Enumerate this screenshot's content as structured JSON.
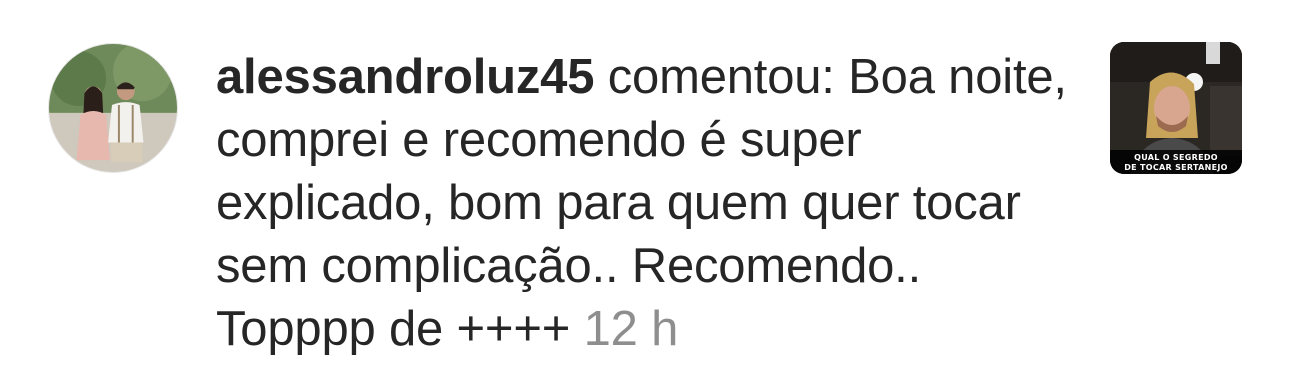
{
  "notification": {
    "username": "alessandroluz45",
    "action": "comentou:",
    "comment_text": "Boa noite, comprei e recomendo é super explicado, bom para quem quer tocar sem complicação.. Recomendo.. Topppp de ++++",
    "timestamp": "12 h",
    "avatar_icon": "profile-photo-couple",
    "thumbnail": {
      "icon": "video-thumbnail",
      "caption_line1": "QUAL O SEGREDO",
      "caption_line2": "DE TOCAR SERTANEJO"
    }
  },
  "colors": {
    "text": "#262626",
    "secondary_text": "#8e8e8e",
    "background": "#ffffff"
  }
}
